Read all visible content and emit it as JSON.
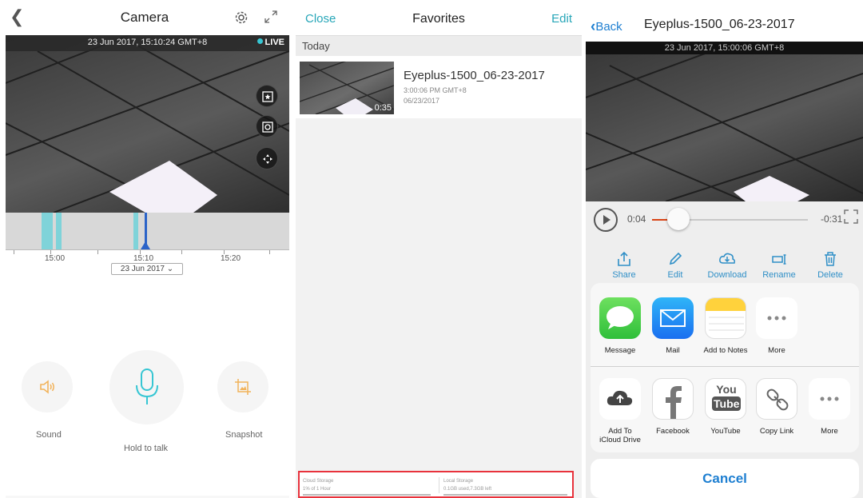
{
  "camera_screen": {
    "title": "Camera",
    "back_icon": "chevron-left-icon",
    "timestamp": "23 Jun 2017, 15:10:24 GMT+8",
    "live_label": "LIVE",
    "timeline": {
      "tick_labels": [
        "15:00",
        "15:10",
        "15:20"
      ],
      "date_selector": "23 Jun 2017 ⌄"
    },
    "controls": {
      "sound_label": "Sound",
      "talk_label": "Hold to talk",
      "snapshot_label": "Snapshot"
    },
    "colors": {
      "accent": "#36c6d3",
      "timeline_clip": "#7fd3d9",
      "cursor": "#2b63c8",
      "control_icon": "#f2b35b"
    }
  },
  "favorites_screen": {
    "title": "Favorites",
    "close_label": "Close",
    "edit_label": "Edit",
    "section_header": "Today",
    "items": [
      {
        "name": "Eyeplus-1500_06-23-2017",
        "time": "3:00:06 PM GMT+8",
        "date": "06/23/2017",
        "duration": "0:35"
      }
    ],
    "storage": {
      "cloud_title": "Cloud Storage",
      "cloud_detail": "1% of 1 Hour",
      "local_title": "Local Storage",
      "local_detail": "0.1GB used,7.3GB left"
    },
    "colors": {
      "link": "#27a6b8",
      "highlight_box": "#e8323c"
    }
  },
  "player_screen": {
    "back_label": "Back",
    "title": "Eyeplus-1500_06-23-2017",
    "timestamp": "23 Jun 2017, 15:00:06 GMT+8",
    "elapsed": "0:04",
    "remaining": "-0:31",
    "progress": 0.11,
    "actions": [
      "Share",
      "Edit",
      "Download",
      "Rename",
      "Delete"
    ],
    "share_apps": [
      {
        "label": "Message",
        "icon": "message-icon"
      },
      {
        "label": "Mail",
        "icon": "mail-icon"
      },
      {
        "label": "Add to Notes",
        "icon": "notes-icon"
      },
      {
        "label": "More",
        "icon": "more-icon"
      }
    ],
    "share_actions": [
      {
        "label": "Add To\niCloud Drive",
        "icon": "icloud-upload-icon"
      },
      {
        "label": "Facebook",
        "icon": "facebook-icon"
      },
      {
        "label": "YouTube",
        "icon": "youtube-icon"
      },
      {
        "label": "Copy Link",
        "icon": "link-icon"
      },
      {
        "label": "More",
        "icon": "more-icon"
      }
    ],
    "youtube_logo": [
      "You",
      "Tube"
    ],
    "cancel_label": "Cancel",
    "colors": {
      "ios_blue": "#1e7fd1",
      "action_blue": "#2f8fc7",
      "progress": "#d84315"
    }
  }
}
